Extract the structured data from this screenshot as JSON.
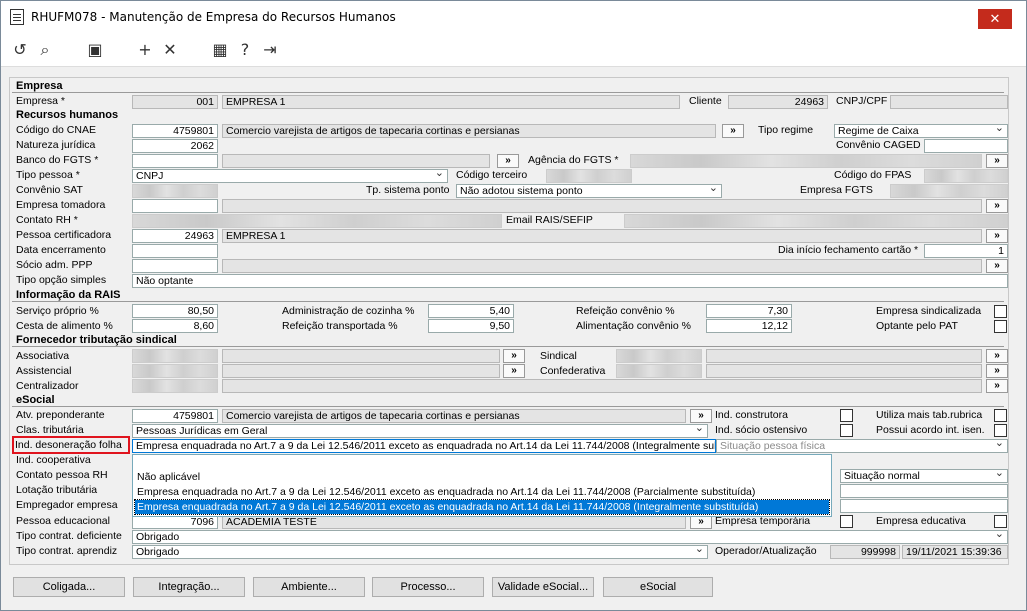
{
  "window": {
    "title": "RHUFM078 - Manutenção de Empresa do Recursos Humanos",
    "close": "✕"
  },
  "toolbar": {
    "icons": [
      "undo-icon",
      "search-icon",
      "save-icon",
      "add-icon",
      "delete-icon",
      "calendar-icon",
      "help-icon",
      "exit-icon"
    ]
  },
  "empresa": {
    "section": "Empresa",
    "label": "Empresa *",
    "code": "001",
    "name": "EMPRESA 1",
    "cliente_label": "Cliente",
    "cliente": "24963",
    "cnpj_label": "CNPJ/CPF"
  },
  "rh": {
    "section": "Recursos humanos",
    "cnae_label": "Código do CNAE",
    "cnae": "4759801",
    "cnae_desc": "Comercio varejista de artigos de tapecaria  cortinas e persianas",
    "tipo_regime_label": "Tipo regime",
    "tipo_regime": "Regime de Caixa",
    "natureza_label": "Natureza jurídica",
    "natureza": "2062",
    "caged_label": "Convênio CAGED",
    "banco_label": "Banco do FGTS *",
    "agencia_label": "Agência do FGTS *",
    "tipo_pessoa_label": "Tipo pessoa *",
    "tipo_pessoa": "CNPJ",
    "cod_terceiro_label": "Código terceiro",
    "fpas_label": "Código do FPAS",
    "convenio_sat_label": "Convênio SAT",
    "tp_ponto_label": "Tp. sistema ponto",
    "tp_ponto": "Não adotou sistema ponto",
    "empresa_fgts_label": "Empresa FGTS",
    "tomadora_label": "Empresa tomadora",
    "contato_label": "Contato RH *",
    "email_label": "Email RAIS/SEFIP",
    "certificadora_label": "Pessoa certificadora",
    "certificadora": "24963",
    "certificadora_nome": "EMPRESA 1",
    "encerramento_label": "Data encerramento",
    "dia_fech_label": "Dia início fechamento cartão *",
    "dia_fech": "1",
    "socio_label": "Sócio adm. PPP",
    "opcao_simples_label": "Tipo opção simples",
    "opcao_simples": "Não optante"
  },
  "rais": {
    "section": "Informação da RAIS",
    "servico_label": "Serviço próprio %",
    "servico": "80,50",
    "adm_label": "Administração de cozinha %",
    "adm": "5,40",
    "refeicao_conv_label": "Refeição convênio %",
    "refeicao_conv": "7,30",
    "sindicalizada_label": "Empresa sindicalizada",
    "cesta_label": "Cesta de alimento %",
    "cesta": "8,60",
    "ref_transp_label": "Refeição transportada %",
    "ref_transp": "9,50",
    "alim_conv_label": "Alimentação convênio %",
    "alim_conv": "12,12",
    "pat_label": "Optante pelo PAT"
  },
  "sindical": {
    "section": "Fornecedor tributação sindical",
    "associativa_label": "Associativa",
    "assistencial_label": "Assistencial",
    "centralizador_label": "Centralizador",
    "sindical_label": "Sindical",
    "confederativa_label": "Confederativa"
  },
  "esocial": {
    "section": "eSocial",
    "atv_label": "Atv. preponderante",
    "atv": "4759801",
    "atv_desc": "Comercio varejista de artigos de tapecaria  cortinas e persianas",
    "ind_construtora_label": "Ind. construtora",
    "mais_rubrica_label": "Utiliza mais tab.rubrica",
    "clas_label": "Clas. tributária",
    "clas": "Pessoas Jurídicas em Geral",
    "socio_ostensivo_label": "Ind. sócio ostensivo",
    "acordo_label": "Possui acordo int. isen.",
    "desoneracao_label": "Ind. desoneração folha",
    "desoneracao": "Empresa enquadrada no Art.7 a 9 da Lei 12.546/2011 exceto as enquadrada no Art.14 da Lei 11.744/2008 (Integralmente substituída)",
    "situacao_pf_label": "Situação pessoa física",
    "cooperativa_label": "Ind. cooperativa",
    "contato_label": "Contato pessoa RH",
    "situacao_normal": "Situação normal",
    "lotacao_label": "Lotação tributária",
    "empregador_label": "Empregador empresa",
    "educacional_label": "Pessoa educacional",
    "educacional": "7096",
    "educacional_nome": "ACADEMIA TESTE",
    "temporaria_label": "Empresa temporária",
    "educativa_label": "Empresa educativa",
    "deficiente_label": "Tipo contrat. deficiente",
    "deficiente": "Obrigado",
    "aprendiz_label": "Tipo contrat. aprendiz",
    "aprendiz": "Obrigado",
    "operador_label": "Operador/Atualização",
    "operador": "999998",
    "data_atualizacao": "19/11/2021 15:39:36"
  },
  "dropdown": {
    "options": [
      "Não aplicável",
      "Empresa enquadrada no Art.7 a 9 da Lei 12.546/2011 exceto as enquadrada no Art.14 da Lei 11.744/2008 (Parcialmente substituída)",
      "Empresa enquadrada no Art.7 a 9 da Lei 12.546/2011 exceto as enquadrada no Art.14 da Lei 11.744/2008 (Integralmente substituída)"
    ]
  },
  "buttons": {
    "coligada": "Coligada...",
    "integracao": "Integração...",
    "ambiente": "Ambiente...",
    "processo": "Processo...",
    "validade": "Validade eSocial...",
    "esocial": "eSocial"
  }
}
